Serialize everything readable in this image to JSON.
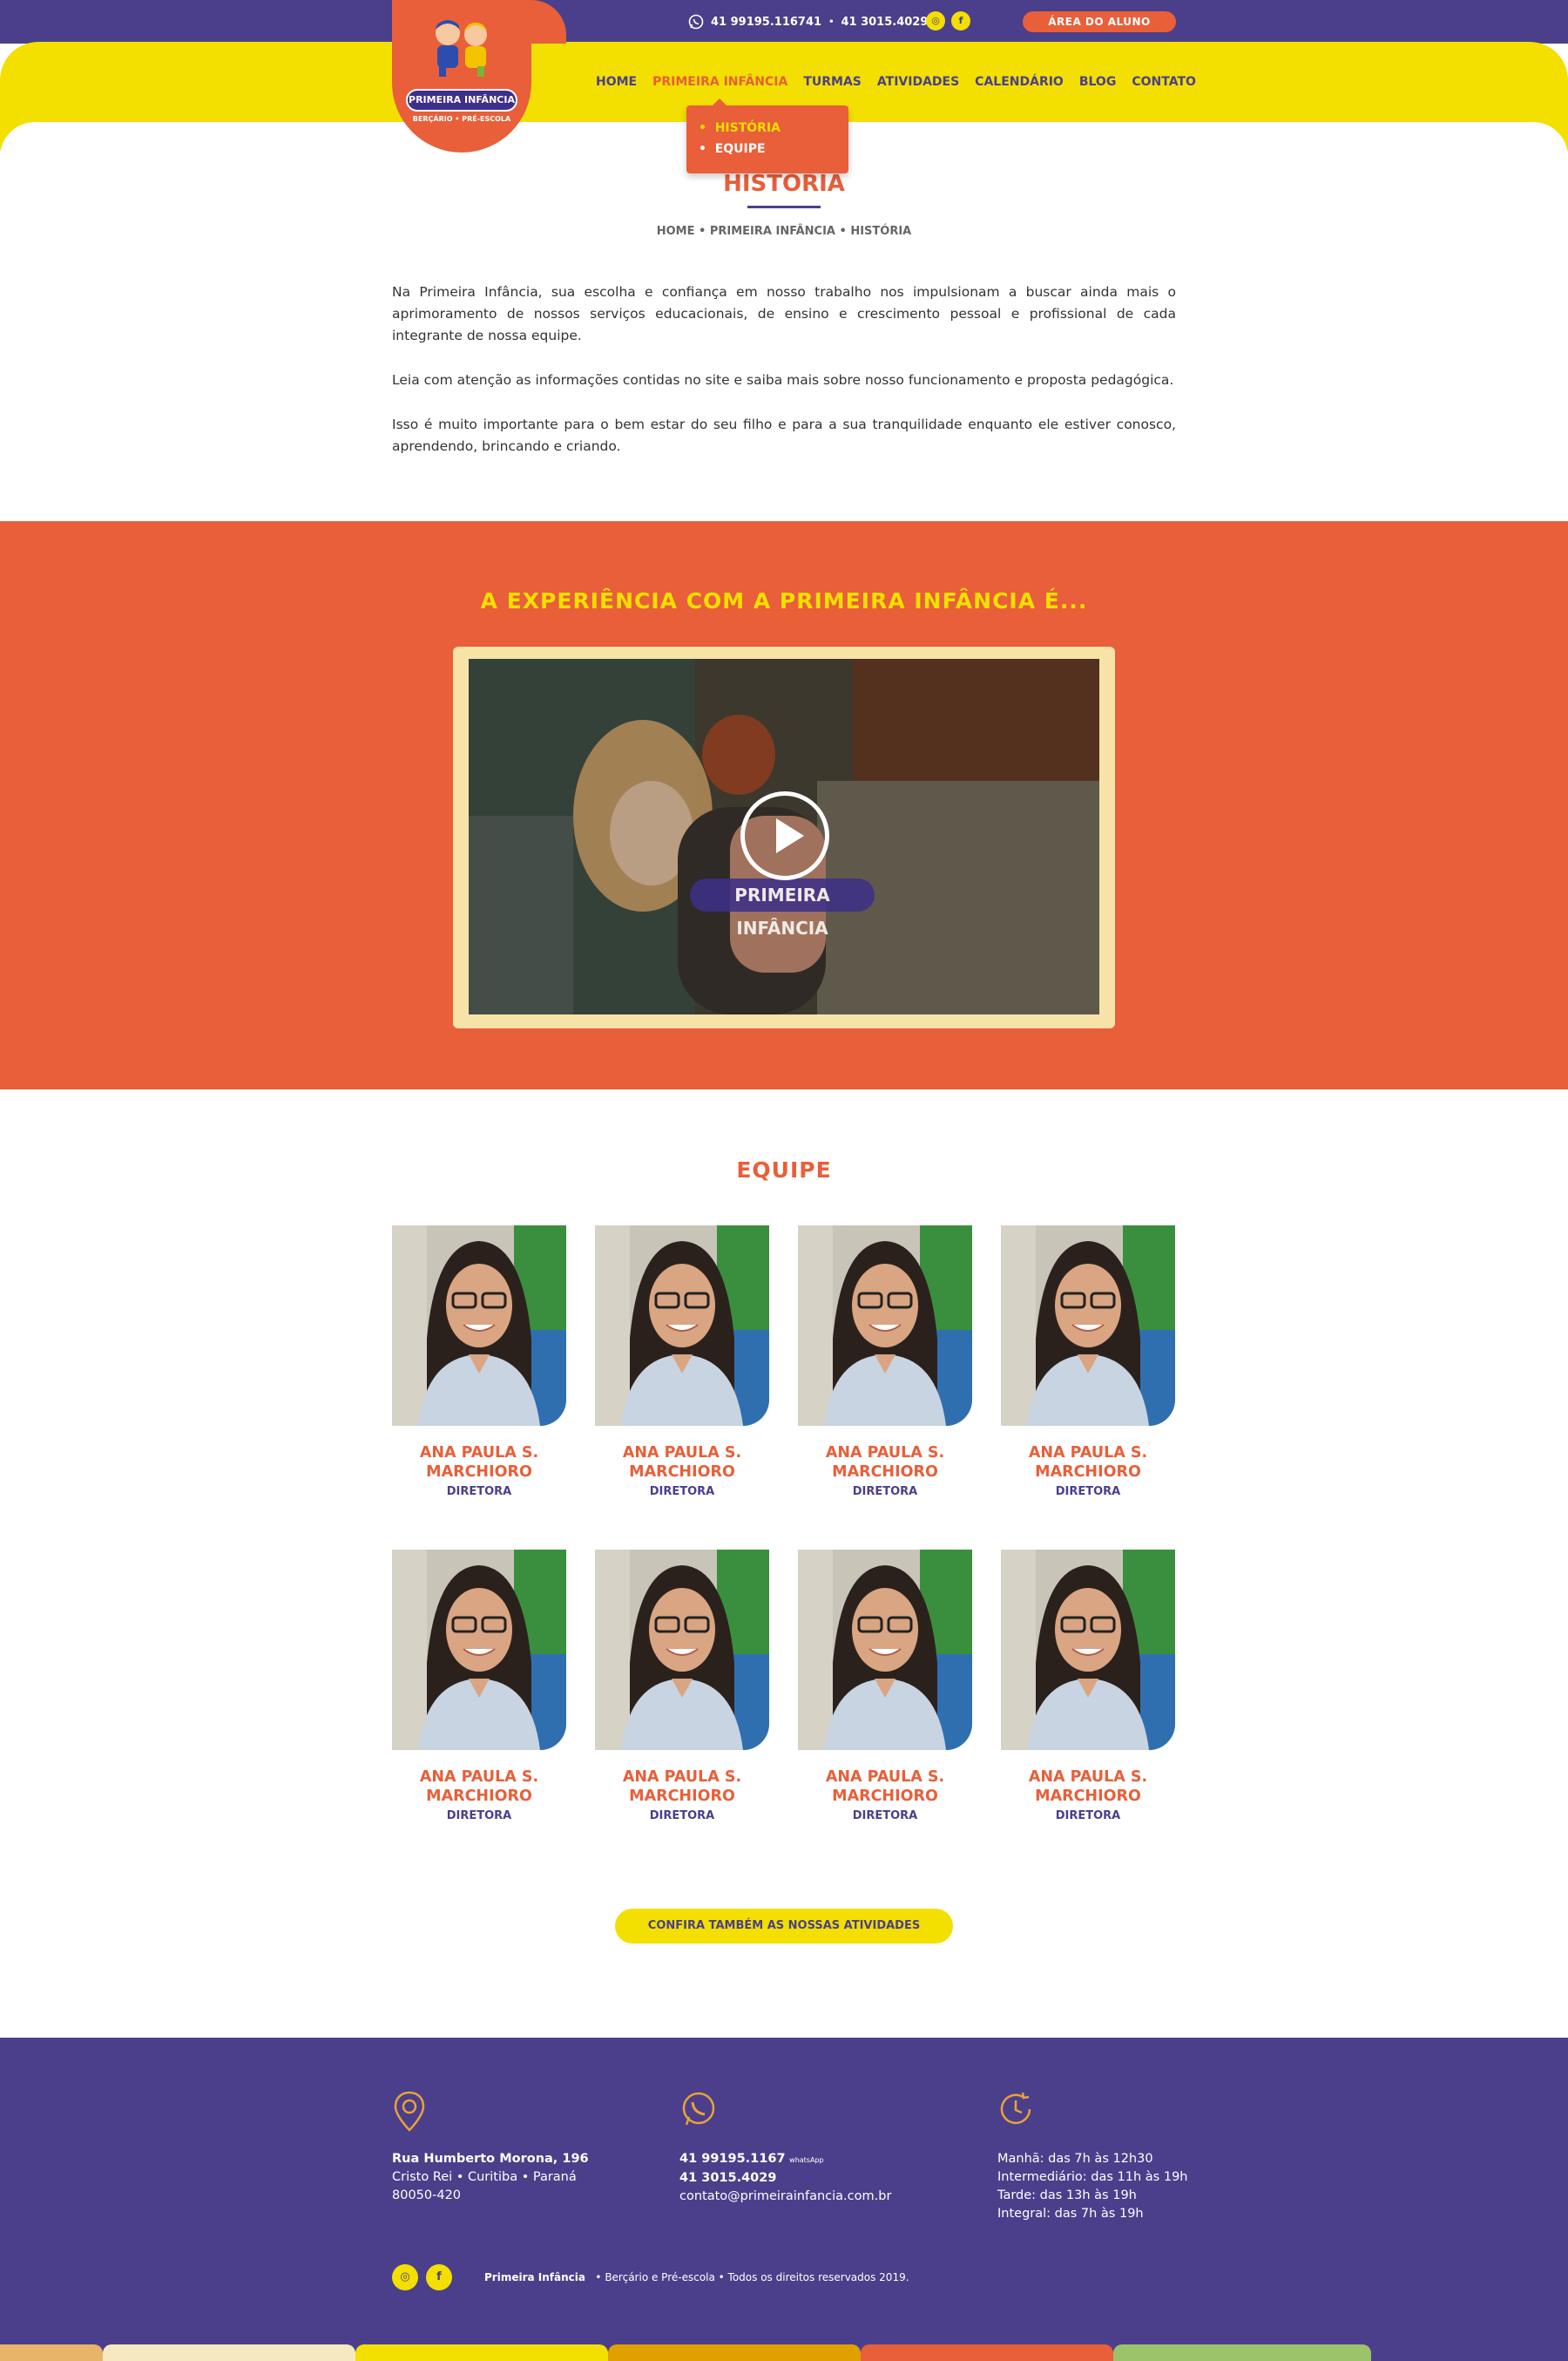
{
  "brand": {
    "name": "PRIMEIRA INFÂNCIA",
    "tagline": "BERÇÁRIO • PRÉ-ESCOLA"
  },
  "topbar": {
    "phone_whatsapp": "41 99195.116741",
    "separator": "•",
    "phone": "41 3015.4029",
    "student_area": "ÁREA DO ALUNO"
  },
  "nav": {
    "items": [
      "HOME",
      "PRIMEIRA INFÂNCIA",
      "TURMAS",
      "ATIVIDADES",
      "CALENDÁRIO",
      "BLOG",
      "CONTATO"
    ],
    "active": "PRIMEIRA INFÂNCIA",
    "submenu": [
      "HISTÓRIA",
      "EQUIPE"
    ]
  },
  "page": {
    "title": "HISTÓRIA",
    "breadcrumb": "HOME • PRIMEIRA INFÂNCIA • HISTÓRIA",
    "paragraphs": [
      "Na Primeira Infância, sua escolha e confiança em nosso trabalho nos impulsionam a buscar ainda mais o aprimoramento de nossos serviços educacionais, de ensino e crescimento pessoal e profissional de cada integrante de nossa equipe.",
      "Leia com atenção as informações contidas no site e saiba mais sobre nosso funcionamento e proposta pedagógica.",
      "Isso é muito importante para o bem estar do seu filho e para a sua tranquilidade enquanto ele estiver conosco, aprendendo, brincando e criando."
    ]
  },
  "video": {
    "title": "A EXPERIÊNCIA COM A PRIMEIRA INFÂNCIA É...",
    "logo_text": "PRIMEIRA INFÂNCIA"
  },
  "team": {
    "title": "EQUIPE",
    "members": [
      {
        "name_line1": "ANA PAULA S.",
        "name_line2": "MARCHIORO",
        "role": "DIRETORA"
      },
      {
        "name_line1": "ANA PAULA S.",
        "name_line2": "MARCHIORO",
        "role": "DIRETORA"
      },
      {
        "name_line1": "ANA PAULA S.",
        "name_line2": "MARCHIORO",
        "role": "DIRETORA"
      },
      {
        "name_line1": "ANA PAULA S.",
        "name_line2": "MARCHIORO",
        "role": "DIRETORA"
      },
      {
        "name_line1": "ANA PAULA S.",
        "name_line2": "MARCHIORO",
        "role": "DIRETORA"
      },
      {
        "name_line1": "ANA PAULA S.",
        "name_line2": "MARCHIORO",
        "role": "DIRETORA"
      },
      {
        "name_line1": "ANA PAULA S.",
        "name_line2": "MARCHIORO",
        "role": "DIRETORA"
      },
      {
        "name_line1": "ANA PAULA S.",
        "name_line2": "MARCHIORO",
        "role": "DIRETORA"
      }
    ],
    "cta": "CONFIRA TAMBÉM AS NOSSAS ATIVIDADES"
  },
  "footer": {
    "address_line1": "Rua Humberto Morona, 196",
    "address_line2": "Cristo Rei  •  Curitiba  •  Paraná",
    "address_line3": "80050-420",
    "whatsapp": "41 99195.1167",
    "whatsapp_label": "whatsApp",
    "phone": "41 3015.4029",
    "email": "contato@primeirainfancia.com.br",
    "hours": [
      "Manhã: das 7h às 12h30",
      "Intermediário: das 11h às 19h",
      "Tarde: das 13h às 19h",
      "Integral: das 7h às 19h"
    ],
    "copyright_brand": "Primeira Infância",
    "copyright_rest": "•   Berçário e Pré-escola   •   Todos os direitos reservados 2019."
  },
  "colors": {
    "purple": "#4b3f8b",
    "yellow": "#f3df00",
    "orange": "#e85f39",
    "cream": "#f7e3a8"
  }
}
